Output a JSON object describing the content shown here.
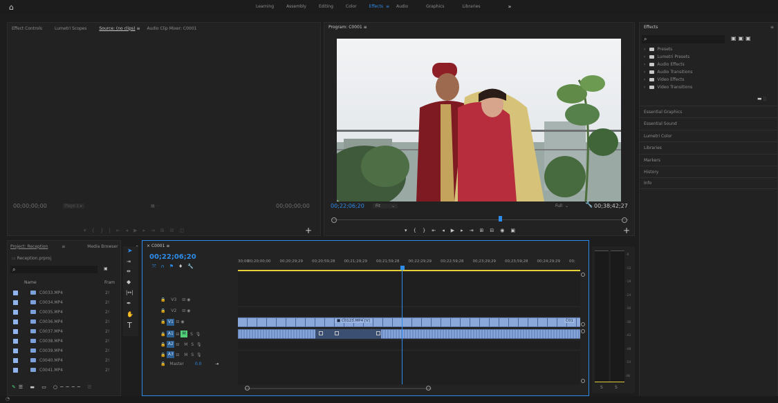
{
  "header": {
    "workspaces": [
      "Learning",
      "Assembly",
      "Editing",
      "Color",
      "Effects",
      "Audio",
      "Graphics",
      "Libraries"
    ],
    "active_workspace": "Effects",
    "more_label": "»"
  },
  "source_panel": {
    "tabs": [
      "Effect Controls",
      "Lumetri Scopes",
      "Source: (no clips)",
      "Audio Clip Mixer: C0001"
    ],
    "active_tab": "Source: (no clips)",
    "menu_icon": "≡",
    "timecode_left": "00;00;00;00",
    "page_label": "Page 1",
    "timecode_right": "00;00;00;00"
  },
  "program_panel": {
    "title": "Program: C0001",
    "menu_icon": "≡",
    "timecode": "00;22;06;20",
    "fit_label": "Fit",
    "full_label": "Full",
    "duration": "00;38;42;27"
  },
  "effects_panel": {
    "title": "Effects",
    "menu_icon": "≡",
    "folders": [
      "Presets",
      "Lumetri Presets",
      "Audio Effects",
      "Audio Transitions",
      "Video Effects",
      "Video Transitions"
    ],
    "sections": [
      "Essential Graphics",
      "Essential Sound",
      "Lumetri Color",
      "Libraries",
      "Markers",
      "History",
      "Info"
    ]
  },
  "project_panel": {
    "tabs": [
      "Project: Reception",
      "Media Browser"
    ],
    "menu_icon": "≡",
    "more": "»",
    "file_name": "Reception.prproj",
    "col_name": "Name",
    "col_frame": "Fram",
    "items": [
      {
        "name": "C0033.MP4",
        "rate": "2!"
      },
      {
        "name": "C0034.MP4",
        "rate": "2!"
      },
      {
        "name": "C0035.MP4",
        "rate": "2!"
      },
      {
        "name": "C0036.MP4",
        "rate": "2!"
      },
      {
        "name": "C0037.MP4",
        "rate": "2!"
      },
      {
        "name": "C0038.MP4",
        "rate": "2!"
      },
      {
        "name": "C0039.MP4",
        "rate": "2!"
      },
      {
        "name": "C0040.MP4",
        "rate": "2!"
      },
      {
        "name": "C0041.MP4",
        "rate": "2!"
      }
    ]
  },
  "timeline": {
    "tab": "C0001",
    "menu_icon": "≡",
    "timecode": "00;22;06;20",
    "ruler": [
      "30;00",
      "00;20;00;00",
      "00;20;29;29",
      "00;20;59;28",
      "00;21;29;29",
      "00;21;59;28",
      "00;22;29;29",
      "00;22;59;28",
      "00;23;29;29",
      "00;23;59;28",
      "00;24;29;29",
      "00;"
    ],
    "video_tracks": [
      "V3",
      "V2",
      "V1"
    ],
    "audio_tracks": [
      "A1",
      "A2",
      "A3"
    ],
    "master_label": "Master",
    "master_value": "0.0",
    "clip_label": "C0123.MP4 [V]",
    "clip_label_end": "C01",
    "m_label": "M",
    "s_label": "S"
  },
  "meter": {
    "scale": [
      "-6",
      "-12",
      "-18",
      "-24",
      "-30",
      "-36",
      "-42",
      "-48",
      "-54",
      "dB"
    ],
    "solo_labels": [
      "S",
      "S"
    ]
  },
  "colors": {
    "accent": "#2d8ceb",
    "clip": "#7f9ed1",
    "green": "#52d179",
    "yellow": "#e5d03a"
  }
}
